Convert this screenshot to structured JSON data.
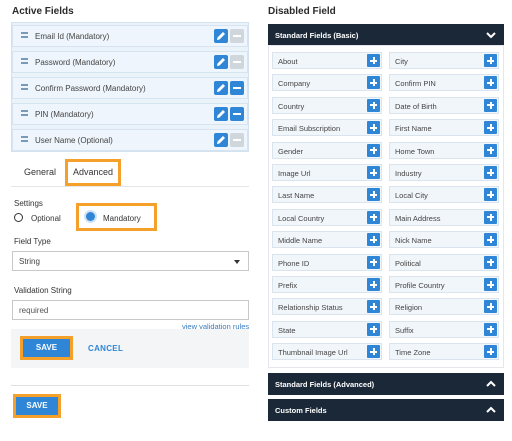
{
  "active": {
    "heading": "Active Fields",
    "fields": [
      {
        "label": "Email Id (Mandatory)",
        "removable": false
      },
      {
        "label": "Password (Mandatory)",
        "removable": false
      },
      {
        "label": "Confirm Password (Mandatory)",
        "removable": true
      },
      {
        "label": "PIN (Mandatory)",
        "removable": true
      },
      {
        "label": "User Name (Optional)",
        "removable": false
      }
    ]
  },
  "tabs": {
    "general": "General",
    "advanced": "Advanced",
    "selected": "advanced"
  },
  "settings": {
    "label": "Settings",
    "optional": "Optional",
    "mandatory": "Mandatory",
    "selected": "mandatory"
  },
  "field_type": {
    "label": "Field Type",
    "value": "String"
  },
  "validation": {
    "label": "Validation String",
    "value": "required",
    "link": "view validation rules"
  },
  "actions": {
    "save": "SAVE",
    "cancel": "CANCEL",
    "save_bottom": "SAVE"
  },
  "disabled": {
    "heading": "Disabled Field",
    "standard_basic": "Standard Fields (Basic)",
    "standard_advanced": "Standard Fields (Advanced)",
    "custom": "Custom Fields",
    "fields": [
      "About",
      "City",
      "Company",
      "Confirm PIN",
      "Country",
      "Date of Birth",
      "Email Subscription",
      "First Name",
      "Gender",
      "Home Town",
      "Image Url",
      "Industry",
      "Last Name",
      "Local City",
      "Local Country",
      "Main Address",
      "Middle Name",
      "Nick Name",
      "Phone ID",
      "Political",
      "Prefix",
      "Profile Country",
      "Relationship Status",
      "Religion",
      "State",
      "Suffix",
      "Thumbnail Image Url",
      "Time Zone"
    ]
  },
  "colors": {
    "accent": "#2f86d6",
    "highlight": "#f5a02a",
    "header": "#1b2838"
  }
}
